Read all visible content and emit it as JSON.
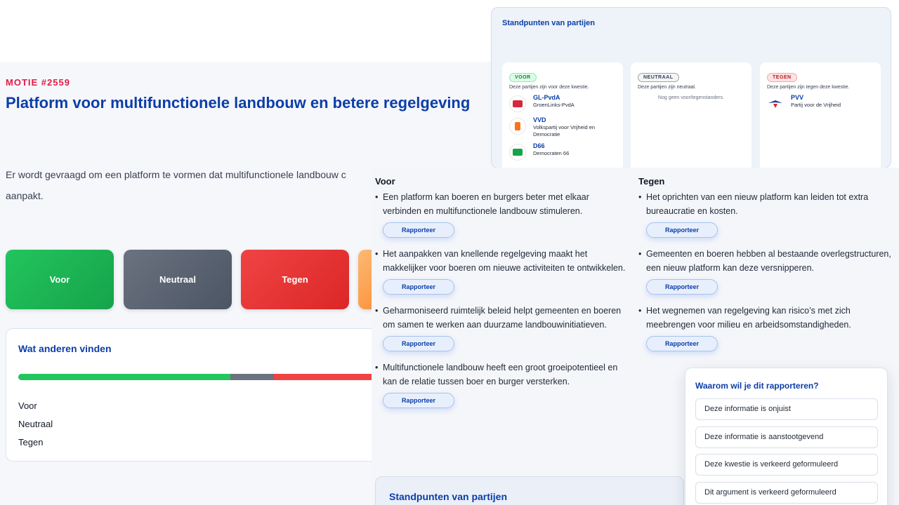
{
  "motion": {
    "number": "MOTIE #2559",
    "title": "Platform voor multifunctionele landbouw en betere regelgeving",
    "intro": "Er wordt gevraagd om een platform te vormen dat multifunctionele landbouw c aanpakt."
  },
  "vote_buttons": {
    "voor": "Voor",
    "neutraal": "Neutraal",
    "tegen": "Tegen"
  },
  "others": {
    "title": "Wat anderen vinden",
    "distribution": {
      "voor": 0.58,
      "neutraal": 0.12,
      "tegen": 0.3
    },
    "legend": [
      "Voor",
      "Neutraal",
      "Tegen"
    ]
  },
  "parties_panel": {
    "title": "Standpunten van partijen",
    "voor": {
      "badge": "VOOR",
      "desc": "Deze partijen zijn voor deze kwestie.",
      "parties": [
        {
          "name": "GL-PvdA",
          "full": "GroenLinks-PvdA",
          "color": "#d7263d"
        },
        {
          "name": "VVD",
          "full": "Volkspartij voor Vrijheid en Democratie",
          "color": "#f97316"
        },
        {
          "name": "D66",
          "full": "Democraten 66",
          "color": "#16a34a"
        }
      ]
    },
    "neutraal": {
      "badge": "NEUTRAAL",
      "desc": "Deze partijen zijn neutraal.",
      "empty": "Nog geen voor/tegenstanders."
    },
    "tegen": {
      "badge": "TEGEN",
      "desc": "Deze partijen zijn tegen deze kwestie.",
      "parties": [
        {
          "name": "PVV",
          "full": "Partij voor de Vrijheid",
          "color": "#1e3a8a"
        }
      ]
    }
  },
  "arguments": {
    "report_label": "Rapporteer",
    "voor": {
      "heading": "Voor",
      "items": [
        "Een platform kan boeren en burgers beter met elkaar verbinden en multifunctionele landbouw stimuleren.",
        "Het aanpakken van knellende regelgeving maakt het makkelijker voor boeren om nieuwe activiteiten te ontwikkelen.",
        "Geharmoniseerd ruimtelijk beleid helpt gemeenten en boeren om samen te werken aan duurzame landbouwinitiatieven.",
        "Multifunctionele landbouw heeft een groot groeipotentieel en kan de relatie tussen boer en burger versterken."
      ]
    },
    "tegen": {
      "heading": "Tegen",
      "items": [
        "Het oprichten van een nieuw platform kan leiden tot extra bureaucratie en kosten.",
        "Gemeenten en boeren hebben al bestaande overlegstructuren, een nieuw platform kan deze versnipperen.",
        "Het wegnemen van regelgeving kan risico’s met zich meebrengen voor milieu en arbeidsomstandigheden."
      ]
    }
  },
  "parties_bottom": {
    "title": "Standpunten van partijen"
  },
  "report_popup": {
    "title": "Waarom wil je dit rapporteren?",
    "options": [
      "Deze informatie is onjuist",
      "Deze informatie is aanstootgevend",
      "Deze kwestie is verkeerd geformuleerd",
      "Dit argument is verkeerd geformuleerd"
    ]
  }
}
